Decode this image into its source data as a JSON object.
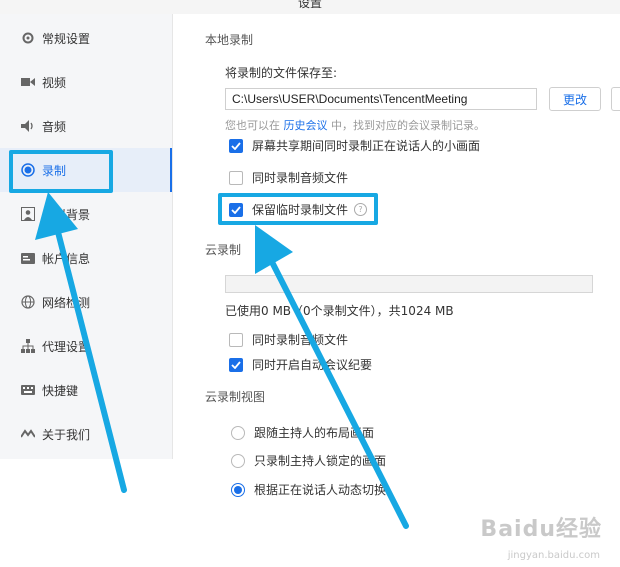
{
  "window": {
    "title": "设置"
  },
  "sidebar": {
    "items": [
      {
        "label": "常规设置",
        "icon": "gear-icon",
        "active": false
      },
      {
        "label": "视频",
        "icon": "video-camera-icon",
        "active": false
      },
      {
        "label": "音频",
        "icon": "speaker-icon",
        "active": false
      },
      {
        "label": "录制",
        "icon": "record-icon",
        "active": true
      },
      {
        "label": "虚拟背景",
        "icon": "person-background-icon",
        "active": false
      },
      {
        "label": "帐户信息",
        "icon": "id-card-icon",
        "active": false
      },
      {
        "label": "网络检测",
        "icon": "globe-icon",
        "active": false
      },
      {
        "label": "代理设置",
        "icon": "network-tree-icon",
        "active": false
      },
      {
        "label": "快捷键",
        "icon": "keyboard-icon",
        "active": false
      },
      {
        "label": "关于我们",
        "icon": "logo-icon",
        "active": false
      }
    ]
  },
  "local_recording": {
    "section_title": "本地录制",
    "save_to_label": "将录制的文件保存至:",
    "save_path": "C:\\Users\\USER\\Documents\\TencentMeeting",
    "change_button": "更改",
    "hint_prefix": "您也可以在",
    "hint_link": "历史会议",
    "hint_suffix": "中，找到对应的会议录制记录。",
    "options": [
      {
        "label": "屏幕共享期间同时录制正在说话人的小画面",
        "checked": true
      },
      {
        "label": "同时录制音频文件",
        "checked": false
      },
      {
        "label": "保留临时录制文件",
        "checked": true,
        "help_icon": "?"
      }
    ]
  },
  "cloud_recording": {
    "section_title": "云录制",
    "usage_text": "已使用0 MB（0个录制文件），共1024 MB",
    "usage_fraction": 0,
    "options": [
      {
        "label": "同时录制音频文件",
        "checked": false
      },
      {
        "label": "同时开启自动会议纪要",
        "checked": true
      }
    ]
  },
  "cloud_view": {
    "section_title": "云录制视图",
    "options": [
      {
        "label": "跟随主持人的布局画面",
        "selected": false
      },
      {
        "label": "只录制主持人锁定的画面",
        "selected": false
      },
      {
        "label": "根据正在说话人动态切换",
        "selected": true
      }
    ]
  },
  "watermark": {
    "brand": "Baidu经验",
    "url": "jingyan.baidu.com"
  },
  "colors": {
    "accent": "#1a6fe8",
    "annotation": "#17a8e3"
  }
}
